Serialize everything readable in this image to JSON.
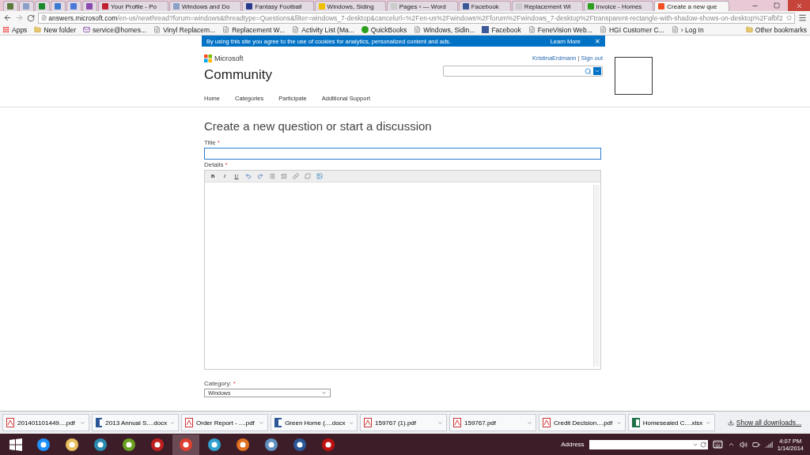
{
  "browser": {
    "tabs": [
      {
        "color": "#5b7a3a",
        "selected": false
      },
      {
        "color": "#8aa0c8",
        "selected": false
      },
      {
        "color": "#1a8a2a",
        "selected": false
      },
      {
        "color": "#3a7ad0",
        "selected": false
      },
      {
        "color": "#4a78d8",
        "selected": false
      },
      {
        "color": "#8a4ab0",
        "selected": false
      },
      {
        "title": "Your Profile - Po",
        "color": "#c02030",
        "selected": false
      },
      {
        "title": "Windows and Do",
        "color": "#8aa0c8",
        "selected": false
      },
      {
        "title": "Fantasy Football",
        "color": "#2a3a8a",
        "selected": false
      },
      {
        "title": "Windows, Siding",
        "color": "#f0c000",
        "selected": false
      },
      {
        "title": "Pages ‹ — Word",
        "color": "#cccccc",
        "selected": false
      },
      {
        "title": "Facebook",
        "color": "#3b5998",
        "selected": false
      },
      {
        "title": "Replacement Wi",
        "color": "#cccccc",
        "selected": false
      },
      {
        "title": "Invoice - Homes",
        "color": "#2ca01c",
        "selected": false
      },
      {
        "title": "Create a new que",
        "color": "#f25022",
        "selected": true
      }
    ],
    "address": {
      "host": "answers.microsoft.com",
      "path": "/en-us/newthread?forum=windows&threadtype=Questions&filter=windows_7-desktop&cancelurl=%2Fen-us%2Fwindows%2Fforum%2Fwindows_7-desktop%2Ftransparent-rectangle-with-shadow-shows-on-desktop%2Fafbf2"
    },
    "bookmarks": [
      {
        "label": "Apps",
        "kind": "apps"
      },
      {
        "label": "New folder",
        "kind": "folder"
      },
      {
        "label": "service@homes...",
        "kind": "mail"
      },
      {
        "label": "Vinyl Replacem...",
        "kind": "page"
      },
      {
        "label": "Replacement W...",
        "kind": "page"
      },
      {
        "label": "Activity List (Ma...",
        "kind": "page"
      },
      {
        "label": "QuickBooks",
        "kind": "qb"
      },
      {
        "label": "Windows, Sidin...",
        "kind": "page"
      },
      {
        "label": "Facebook",
        "kind": "fb"
      },
      {
        "label": "FeneVision Web...",
        "kind": "page"
      },
      {
        "label": "HGI Customer C...",
        "kind": "page"
      },
      {
        "label": "› Log In",
        "kind": "page"
      }
    ],
    "other_bookmarks": "Other bookmarks"
  },
  "cookie_banner": {
    "text": "By using this site you agree to the use of cookies for analytics, personalized content and ads.",
    "link": "Learn More",
    "close": "✕"
  },
  "header": {
    "brand": "Microsoft",
    "site": "Community",
    "user": "KristinaErdmann",
    "separator": "|",
    "sign_out": "Sign out"
  },
  "nav": [
    "Home",
    "Categories",
    "Participate",
    "Additional Support"
  ],
  "form": {
    "heading": "Create a new question or start a discussion",
    "title_label": "Title",
    "details_label": "Details",
    "required": "*",
    "toolbar": [
      {
        "kind": "bold",
        "label": "B"
      },
      {
        "kind": "italic",
        "label": "I"
      },
      {
        "kind": "underline",
        "label": "U"
      },
      {
        "kind": "undo"
      },
      {
        "kind": "redo"
      },
      {
        "kind": "bullets"
      },
      {
        "kind": "numbers"
      },
      {
        "kind": "link"
      },
      {
        "kind": "unlink"
      },
      {
        "kind": "image"
      }
    ],
    "category_label": "Category:",
    "category_value": "Windows"
  },
  "downloads": {
    "items": [
      {
        "name": "201401101449....pdf",
        "kind": "pdf"
      },
      {
        "name": "2013 Annual S....docx",
        "kind": "word"
      },
      {
        "name": "Order Report - ....pdf",
        "kind": "pdf"
      },
      {
        "name": "Green Home (....docx",
        "kind": "word"
      },
      {
        "name": "159767 (1).pdf",
        "kind": "pdf"
      },
      {
        "name": "159767.pdf",
        "kind": "pdf"
      },
      {
        "name": "Credit Decision....pdf",
        "kind": "pdf"
      },
      {
        "name": "Homesealed C....xlsx",
        "kind": "excel"
      }
    ],
    "show_all": "Show all downloads..."
  },
  "taskbar": {
    "apps": [
      {
        "color": "#1e90ff",
        "selected": false
      },
      {
        "color": "#e8c060",
        "selected": false
      },
      {
        "color": "#2a8ab0",
        "selected": false
      },
      {
        "color": "#6aa020",
        "selected": false
      },
      {
        "color": "#c02020",
        "selected": false
      },
      {
        "color": "#e04030",
        "selected": true
      },
      {
        "color": "#30a0d0",
        "selected": false
      },
      {
        "color": "#e07020",
        "selected": false
      },
      {
        "color": "#6090c0",
        "selected": false
      },
      {
        "color": "#2b5797",
        "selected": false
      },
      {
        "color": "#c01010",
        "selected": false
      }
    ],
    "address_label": "Address",
    "time": "4:07 PM",
    "date": "1/14/2014"
  }
}
